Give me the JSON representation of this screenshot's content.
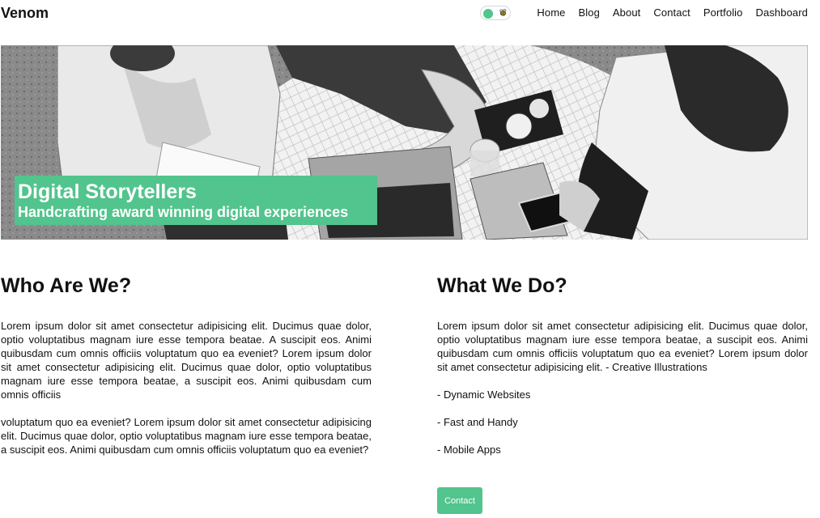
{
  "nav": {
    "brand": "Venom",
    "links": [
      "Home",
      "Blog",
      "About",
      "Contact",
      "Portfolio",
      "Dashboard"
    ],
    "theme_toggle": {
      "state": "on",
      "icon": "bee-icon"
    }
  },
  "hero": {
    "image": "black-and-white photo of people working at a table with laptops and a phone",
    "title": "Digital Storytellers",
    "subtitle": "Handcrafting award winning digital experiences"
  },
  "about": {
    "heading": "Who Are We?",
    "paragraph1": "Lorem ipsum dolor sit amet consectetur adipisicing elit. Ducimus quae dolor, optio voluptatibus magnam iure esse tempora beatae. A suscipit eos. Animi quibusdam cum omnis officiis voluptatum quo ea eveniet? Lorem ipsum dolor sit amet consectetur adipisicing elit. Ducimus quae dolor, optio voluptatibus magnam iure esse tempora beatae, a suscipit eos. Animi quibusdam cum omnis officiis",
    "paragraph2": "voluptatum quo ea eveniet? Lorem ipsum dolor sit amet consectetur adipisicing elit. Ducimus quae dolor, optio voluptatibus magnam iure esse tempora beatae, a suscipit eos. Animi quibusdam cum omnis officiis voluptatum quo ea eveniet?"
  },
  "services": {
    "heading": "What We Do?",
    "paragraph": "Lorem ipsum dolor sit amet consectetur adipisicing elit. Ducimus quae dolor, optio voluptatibus magnam iure esse tempora beatae, a suscipit eos. Animi quibusdam cum omnis officiis voluptatum quo ea eveniet? Lorem ipsum dolor sit amet consectetur adipisicing elit. - Creative Illustrations",
    "items": [
      "- Dynamic Websites",
      "- Fast and Handy",
      "- Mobile Apps"
    ],
    "button": "Contact"
  },
  "colors": {
    "accent": "#52c48d",
    "text": "#111111",
    "background": "#ffffff"
  }
}
